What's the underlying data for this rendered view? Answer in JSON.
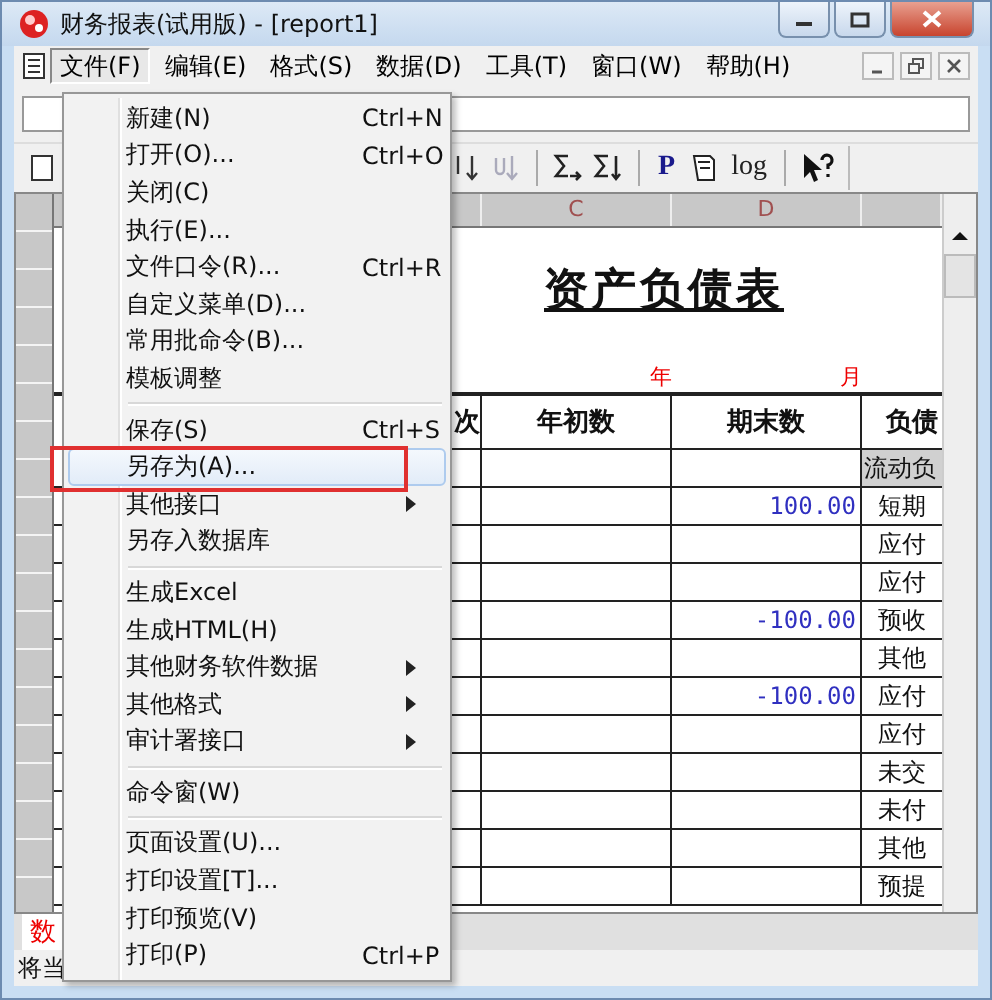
{
  "window": {
    "title": "财务报表(试用版) - [report1]"
  },
  "menu_bar": [
    {
      "label": "文件(F)",
      "selected": true
    },
    {
      "label": "编辑(E)",
      "selected": false
    },
    {
      "label": "格式(S)",
      "selected": false
    },
    {
      "label": "数据(D)",
      "selected": false
    },
    {
      "label": "工具(T)",
      "selected": false
    },
    {
      "label": "窗口(W)",
      "selected": false
    },
    {
      "label": "帮助(H)",
      "selected": false
    }
  ],
  "toolbar": [
    {
      "kind": "sort_desc",
      "disabled": false
    },
    {
      "kind": "sort_asc",
      "disabled": true
    },
    {
      "kind": "separator"
    },
    {
      "kind": "sum",
      "disabled": false
    },
    {
      "kind": "sum_down",
      "disabled": false
    },
    {
      "kind": "separator"
    },
    {
      "kind": "text",
      "label": "P"
    },
    {
      "kind": "page",
      "disabled": false
    },
    {
      "kind": "text",
      "label": "log"
    },
    {
      "kind": "separator"
    },
    {
      "kind": "help",
      "disabled": false
    }
  ],
  "sheet": {
    "column_headers": [
      "C",
      "D"
    ],
    "title": "资产负债表",
    "date_labels": [
      "年",
      "月"
    ],
    "header": [
      "次",
      "年初数",
      "期末数",
      "负债"
    ],
    "rows": [
      {
        "section": true,
        "liability": "流动负"
      },
      {
        "section": false,
        "closing": "100.00",
        "liability": "短期"
      },
      {
        "section": false,
        "liability": "应付"
      },
      {
        "section": false,
        "liability": "应付"
      },
      {
        "section": false,
        "closing": "-100.00",
        "liability": "预收"
      },
      {
        "section": false,
        "liability": "其他"
      },
      {
        "section": false,
        "closing": "-100.00",
        "liability": "应付"
      },
      {
        "section": false,
        "liability": "应付"
      },
      {
        "section": false,
        "liability": "未交"
      },
      {
        "section": false,
        "liability": "未付"
      },
      {
        "section": false,
        "liability": "其他"
      },
      {
        "section": false,
        "liability": "预提"
      }
    ]
  },
  "sheet_tab": "数",
  "status_bar": "将当",
  "file_menu": [
    {
      "kind": "item",
      "label": "新建(N)",
      "shortcut": "Ctrl+N",
      "selected": false,
      "submenu": false
    },
    {
      "kind": "item",
      "label": "打开(O)...",
      "shortcut": "Ctrl+O",
      "selected": false,
      "submenu": false
    },
    {
      "kind": "item",
      "label": "关闭(C)",
      "selected": false,
      "submenu": false
    },
    {
      "kind": "item",
      "label": "执行(E)...",
      "selected": false,
      "submenu": false
    },
    {
      "kind": "item",
      "label": "文件口令(R)...",
      "shortcut": "Ctrl+R",
      "selected": false,
      "submenu": false
    },
    {
      "kind": "item",
      "label": "自定义菜单(D)...",
      "selected": false,
      "submenu": false
    },
    {
      "kind": "item",
      "label": "常用批命令(B)...",
      "selected": false,
      "submenu": false
    },
    {
      "kind": "item",
      "label": "模板调整",
      "selected": false,
      "submenu": false
    },
    {
      "kind": "separator"
    },
    {
      "kind": "item",
      "label": "保存(S)",
      "shortcut": "Ctrl+S",
      "selected": false,
      "submenu": false
    },
    {
      "kind": "item",
      "label": "另存为(A)...",
      "selected": true,
      "submenu": false,
      "annotated": true
    },
    {
      "kind": "item",
      "label": "其他接口",
      "selected": false,
      "submenu": true
    },
    {
      "kind": "item",
      "label": "另存入数据库",
      "selected": false,
      "submenu": false
    },
    {
      "kind": "separator"
    },
    {
      "kind": "item",
      "label": "生成Excel",
      "selected": false,
      "submenu": false
    },
    {
      "kind": "item",
      "label": "生成HTML(H)",
      "selected": false,
      "submenu": false
    },
    {
      "kind": "item",
      "label": "其他财务软件数据",
      "selected": false,
      "submenu": true
    },
    {
      "kind": "item",
      "label": "其他格式",
      "selected": false,
      "submenu": true
    },
    {
      "kind": "item",
      "label": "审计署接口",
      "selected": false,
      "submenu": true
    },
    {
      "kind": "separator"
    },
    {
      "kind": "item",
      "label": "命令窗(W)",
      "selected": false,
      "submenu": false
    },
    {
      "kind": "separator"
    },
    {
      "kind": "item",
      "label": "页面设置(U)...",
      "selected": false,
      "submenu": false
    },
    {
      "kind": "item",
      "label": "打印设置[T]...",
      "selected": false,
      "submenu": false
    },
    {
      "kind": "item",
      "label": "打印预览(V)",
      "selected": false,
      "submenu": false
    },
    {
      "kind": "item",
      "label": "打印(P)",
      "shortcut": "Ctrl+P",
      "selected": false,
      "submenu": false
    }
  ]
}
